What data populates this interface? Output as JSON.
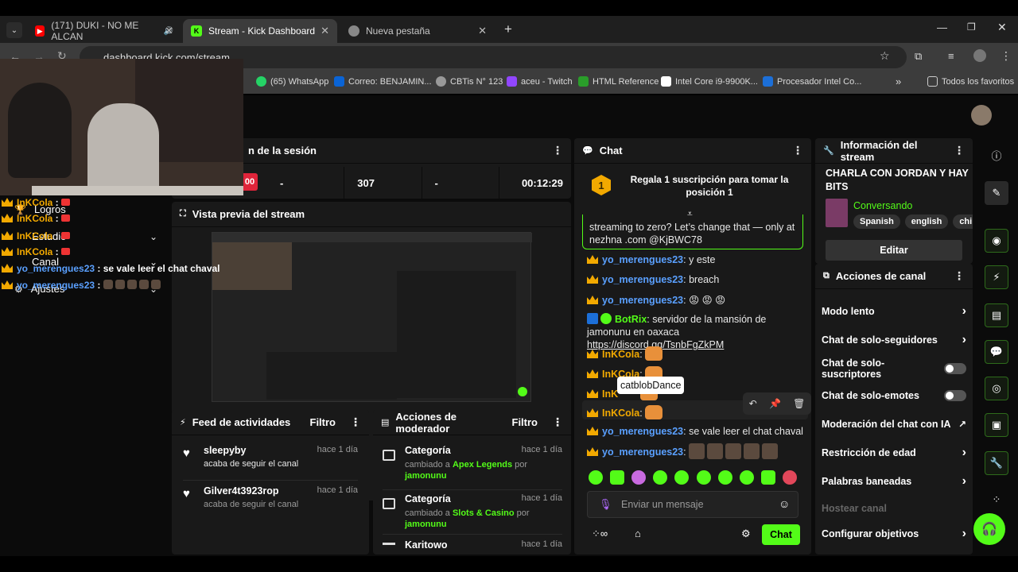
{
  "browser": {
    "tabs": [
      {
        "title": "(171) DUKI - NO ME ALCAN",
        "icon": "youtube-icon"
      },
      {
        "title": "Stream - Kick Dashboard",
        "icon": "kick-icon"
      },
      {
        "title": "Nueva pestaña",
        "icon": "chrome-icon"
      }
    ],
    "new_tab": "+",
    "url": "dashboard.kick.com/stream",
    "bookmarks": [
      "(65) WhatsApp",
      "Correo: BENJAMIN...",
      "CBTis N° 123",
      "aceu - Twitch",
      "HTML Reference",
      "Intel Core i9-9900K...",
      "Procesador Intel Co..."
    ],
    "all_bookmarks": "Todos los favoritos"
  },
  "overlay_chat": [
    {
      "user": "InKCola",
      "text": ""
    },
    {
      "user": "InKCola",
      "text": ""
    },
    {
      "user": "InKCola",
      "text": ""
    },
    {
      "user": "InKCola",
      "text": ""
    },
    {
      "user": "yo_merengues23",
      "text": "se vale leer el chat chaval"
    },
    {
      "user": "yo_merengues23",
      "text": ""
    }
  ],
  "sidebar": {
    "items": [
      "Logros",
      "Estudio",
      "Canal",
      "Ajustes"
    ]
  },
  "session": {
    "title": "n de la sesión",
    "stats": [
      "-",
      "307",
      "-",
      "00:12:29"
    ],
    "partial_badge": "00"
  },
  "preview": {
    "title": "Vista previa del stream"
  },
  "activity_feed": {
    "title": "Feed de actividades",
    "filter": "Filtro",
    "items": [
      {
        "user": "sleepyby",
        "desc": "acaba de seguir el canal",
        "time": "hace 1 día"
      },
      {
        "user": "Gilver4t3923rop",
        "desc": "acaba de seguir el canal",
        "time": "hace 1 día"
      }
    ]
  },
  "mod_actions": {
    "title": "Acciones de moderador",
    "filter": "Filtro",
    "items": [
      {
        "title": "Categoría",
        "pre": "cambiado a ",
        "value": "Apex Legends",
        "mid": " por ",
        "by": "jamonunu",
        "time": "hace 1 día"
      },
      {
        "title": "Categoría",
        "pre": "cambiado a ",
        "value": "Slots & Casino",
        "mid": " por ",
        "by": "jamonunu",
        "time": "hace 1 día"
      },
      {
        "title": "Karitowo",
        "pre": "",
        "value": "",
        "mid": "",
        "by": "",
        "time": "hace 1 día"
      }
    ]
  },
  "chat": {
    "title": "Chat",
    "gift": "Regala 1 suscripción para tomar la posición 1",
    "gift_rank": "1",
    "pinned": "streaming to zero? Let’s change that — only at nezhna .com @KjBWC78",
    "messages": [
      {
        "user": "yo_merengues23",
        "sep": ": ",
        "text": "y este"
      },
      {
        "user": "yo_merengues23",
        "sep": ": ",
        "text": "breach"
      },
      {
        "user": "yo_merengues23",
        "sep": ": ",
        "text": "😡 😡 😡"
      },
      {
        "user": "BotRix",
        "sep": ": ",
        "text": "servidor de la mansión de jamonunu en oaxaca ",
        "link": "https://discord.gg/TsnbFgZkPM"
      },
      {
        "user": "InKCola",
        "sep": ": ",
        "text": ""
      },
      {
        "user": "InKCola",
        "sep": ": ",
        "text": ""
      },
      {
        "user": "InK",
        "sep": "",
        "text": ""
      },
      {
        "user": "InKCola",
        "sep": ": ",
        "text": ""
      },
      {
        "user": "yo_merengues23",
        "sep": ": ",
        "text": "se vale leer el chat chaval"
      },
      {
        "user": "yo_merengues23",
        "sep": ": ",
        "text": ""
      }
    ],
    "tooltip": "catblobDance",
    "input_placeholder": "Enviar un mensaje",
    "send_label": "Chat"
  },
  "stream_info": {
    "title": "Información del stream",
    "stream_title": "CHARLA CON JORDAN Y HAY BITS",
    "category": "Conversando",
    "tags": [
      "Spanish",
      "english",
      "chil"
    ],
    "edit_label": "Editar"
  },
  "channel_actions": {
    "title": "Acciones de canal",
    "items": [
      {
        "label": "Modo lento",
        "control": "chevron"
      },
      {
        "label": "Chat de solo-seguidores",
        "control": "chevron"
      },
      {
        "label": "Chat de solo-suscriptores",
        "control": "toggle"
      },
      {
        "label": "Chat de solo-emotes",
        "control": "toggle"
      },
      {
        "label": "Moderación del chat con IA",
        "control": "external"
      },
      {
        "label": "Restricción de edad",
        "control": "chevron"
      },
      {
        "label": "Palabras baneadas",
        "control": "chevron"
      },
      {
        "label": "Hostear canal",
        "control": "none"
      },
      {
        "label": "Configurar objetivos",
        "control": "chevron"
      }
    ]
  },
  "colors": {
    "accent": "#53fc18",
    "panel": "#191919",
    "page": "#0b0b0b",
    "username_blue": "#5aa0ff",
    "username_orange": "#f2a900"
  }
}
